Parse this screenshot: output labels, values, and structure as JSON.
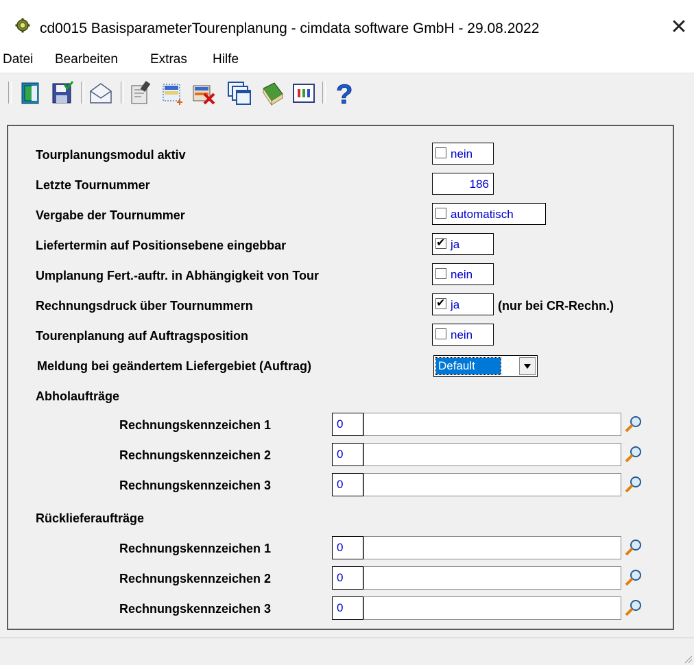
{
  "window": {
    "title": "cd0015 BasisparameterTourenplanung - cimdata software GmbH - 29.08.2022",
    "close_glyph": "✕"
  },
  "menu": [
    "Datei",
    "Bearbeiten",
    "Extras",
    "Hilfe"
  ],
  "toolbar": {
    "icons": [
      "exit-door-icon",
      "save-disk-icon",
      "mail-envelope-icon",
      "edit-document-icon",
      "new-record-icon",
      "delete-record-icon",
      "window-copy-icon",
      "book-icon",
      "grid-view-icon",
      "help-question-icon"
    ]
  },
  "settings": [
    {
      "label": "Tourplanungsmodul aktiv",
      "type": "checkbox",
      "checked": false,
      "value": "nein"
    },
    {
      "label": "Letzte Tournummer",
      "type": "number",
      "value": "186"
    },
    {
      "label": "Vergabe der Tournummer",
      "type": "checkbox",
      "checked": false,
      "value": "automatisch"
    },
    {
      "label": "Liefertermin auf Positionsebene eingebbar",
      "type": "checkbox",
      "checked": true,
      "value": "ja"
    },
    {
      "label": "Umplanung Fert.-auftr. in Abhängigkeit von Tour",
      "type": "checkbox",
      "checked": false,
      "value": "nein"
    },
    {
      "label": "Rechnungsdruck über Tournummern",
      "type": "checkbox",
      "checked": true,
      "value": "ja",
      "note": "(nur bei CR-Rechn.)"
    },
    {
      "label": "Tourenplanung auf Auftragsposition",
      "type": "checkbox",
      "checked": false,
      "value": "nein"
    },
    {
      "label": "Meldung bei geändertem Liefergebiet (Auftrag)",
      "type": "select",
      "value": "Default"
    }
  ],
  "abholauftraege": {
    "heading": "Abholaufträge",
    "rows": [
      {
        "label": "Rechnungskennzeichen 1",
        "code": "0",
        "desc": ""
      },
      {
        "label": "Rechnungskennzeichen 2",
        "code": "0",
        "desc": ""
      },
      {
        "label": "Rechnungskennzeichen 3",
        "code": "0",
        "desc": ""
      }
    ]
  },
  "ruecklieferauftraege": {
    "heading": "Rücklieferaufträge",
    "rows": [
      {
        "label": "Rechnungskennzeichen 1",
        "code": "0",
        "desc": ""
      },
      {
        "label": "Rechnungskennzeichen 2",
        "code": "0",
        "desc": ""
      },
      {
        "label": "Rechnungskennzeichen 3",
        "code": "0",
        "desc": ""
      }
    ]
  }
}
